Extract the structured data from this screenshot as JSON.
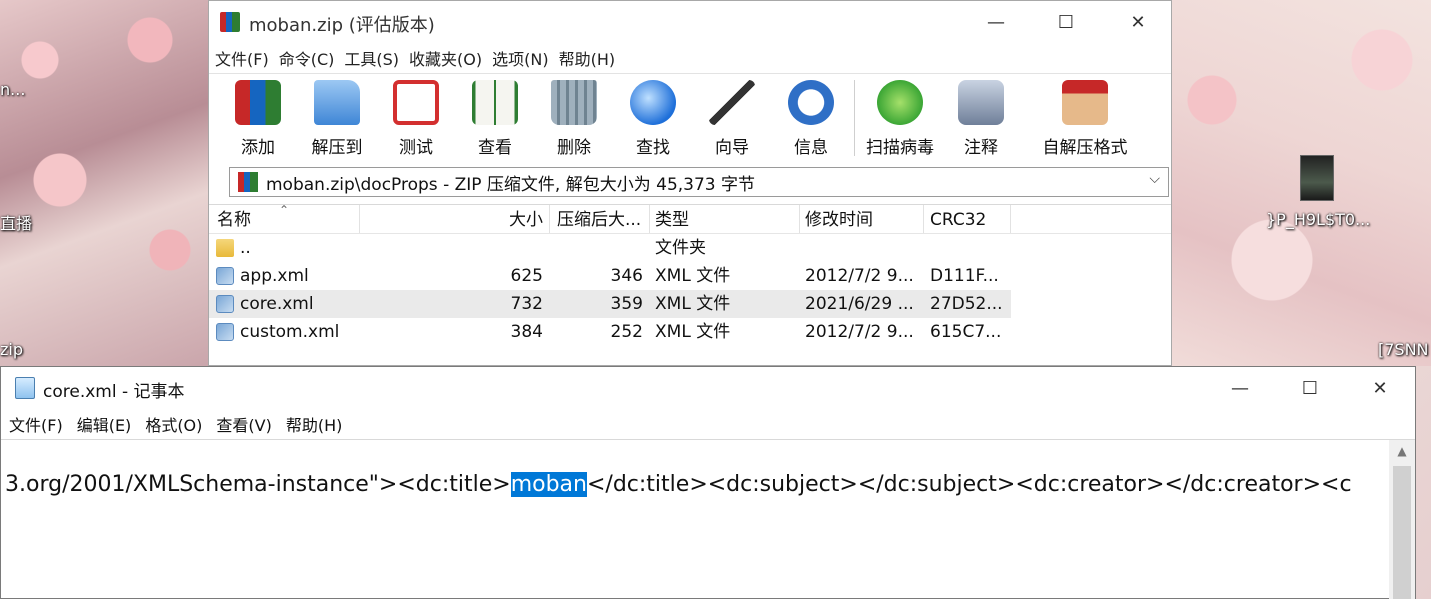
{
  "desktop": {
    "labels": [
      "n...",
      "直播",
      "zip",
      "}P_H9L$T0...",
      "[7SNN"
    ]
  },
  "winrar": {
    "title": "moban.zip (评估版本)",
    "controls": {
      "minimize": "—",
      "maximize": "☐",
      "close": "✕"
    },
    "menu": [
      "文件(F)",
      "命令(C)",
      "工具(S)",
      "收藏夹(O)",
      "选项(N)",
      "帮助(H)"
    ],
    "toolbar": [
      {
        "label": "添加",
        "icon": "add-archive-icon",
        "color": "#c62828"
      },
      {
        "label": "解压到",
        "icon": "extract-folder-icon",
        "color": "#4a90e2"
      },
      {
        "label": "测试",
        "icon": "test-clipboard-icon",
        "color": "#d32f2f"
      },
      {
        "label": "查看",
        "icon": "view-book-icon",
        "color": "#2e7d32"
      },
      {
        "label": "删除",
        "icon": "delete-trash-icon",
        "color": "#8a9ba8"
      },
      {
        "label": "查找",
        "icon": "find-magnifier-icon",
        "color": "#1e6fd9"
      },
      {
        "label": "向导",
        "icon": "wizard-wand-icon",
        "color": "#444444"
      },
      {
        "label": "信息",
        "icon": "info-icon",
        "color": "#2f6fc6"
      },
      {
        "label": "扫描病毒",
        "icon": "virus-scan-icon",
        "color": "#3ba635"
      },
      {
        "label": "注释",
        "icon": "comment-icon",
        "color": "#6f7f99"
      },
      {
        "label": "自解压格式",
        "icon": "sfx-box-icon",
        "color": "#d9a066"
      }
    ],
    "address": "moban.zip\\docProps - ZIP 压缩文件, 解包大小为 45,373 字节",
    "columns": {
      "name": "名称",
      "size": "大小",
      "packed": "压缩后大...",
      "type": "类型",
      "modified": "修改时间",
      "crc": "CRC32"
    },
    "files": [
      {
        "name": "..",
        "size": "",
        "packed": "",
        "type": "文件夹",
        "modified": "",
        "crc": ""
      },
      {
        "name": "app.xml",
        "size": "625",
        "packed": "346",
        "type": "XML 文件",
        "modified": "2012/7/2 9...",
        "crc": "D111F..."
      },
      {
        "name": "core.xml",
        "size": "732",
        "packed": "359",
        "type": "XML 文件",
        "modified": "2021/6/29 ...",
        "crc": "27D52..."
      },
      {
        "name": "custom.xml",
        "size": "384",
        "packed": "252",
        "type": "XML 文件",
        "modified": "2012/7/2 9...",
        "crc": "615C7..."
      }
    ]
  },
  "notepad": {
    "title": "core.xml - 记事本",
    "controls": {
      "minimize": "—",
      "maximize": "☐",
      "close": "✕"
    },
    "menu": [
      "文件(F)",
      "编辑(E)",
      "格式(O)",
      "查看(V)",
      "帮助(H)"
    ],
    "text_before": "3.org/2001/XMLSchema-instance\"><dc:title>",
    "text_selected": "moban",
    "text_after": "</dc:title><dc:subject></dc:subject><dc:creator></dc:creator><c"
  }
}
